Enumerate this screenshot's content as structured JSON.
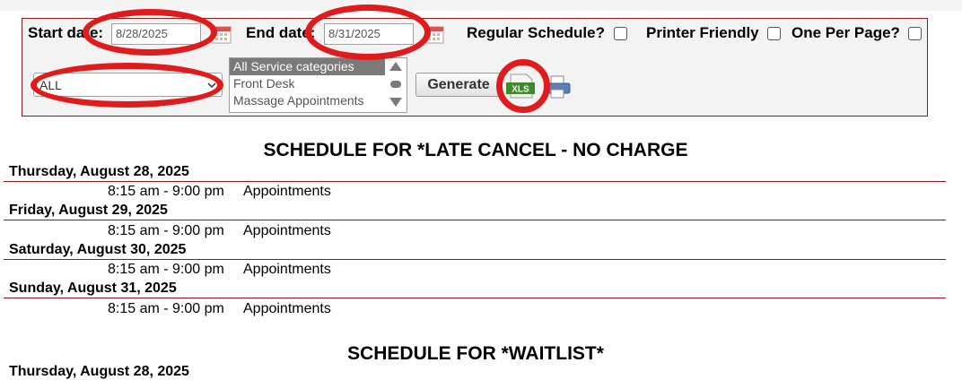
{
  "filters": {
    "start_date_label": "Start date:",
    "start_date_value": "8/28/2025",
    "end_date_label": "End date:",
    "end_date_value": "8/31/2025",
    "regular_schedule_label": "Regular Schedule?",
    "printer_friendly_label": "Printer Friendly",
    "one_per_page_label": "One Per Page?",
    "staff_select_value": "ALL",
    "service_categories": [
      "All Service categories",
      "Front Desk",
      "Massage Appointments"
    ],
    "generate_label": "Generate",
    "xls_label": "XLS"
  },
  "schedules": [
    {
      "title": "SCHEDULE FOR *LATE CANCEL - NO CHARGE",
      "days": [
        {
          "date": "Thursday, August 28, 2025",
          "time": "8:15 am - 9:00 pm",
          "desc": "Appointments"
        },
        {
          "date": "Friday, August 29, 2025",
          "time": "8:15 am - 9:00 pm",
          "desc": "Appointments"
        },
        {
          "date": "Saturday, August 30, 2025",
          "time": "8:15 am - 9:00 pm",
          "desc": "Appointments"
        },
        {
          "date": "Sunday, August 31, 2025",
          "time": "8:15 am - 9:00 pm",
          "desc": "Appointments"
        }
      ]
    },
    {
      "title": "SCHEDULE FOR *WAITLIST*",
      "days": [
        {
          "date": "Thursday, August 28, 2025"
        }
      ]
    }
  ],
  "colors": {
    "rule": "#8b1a1a",
    "annotation": "#e01b1b",
    "panel_bg": "#f3f3f3"
  }
}
